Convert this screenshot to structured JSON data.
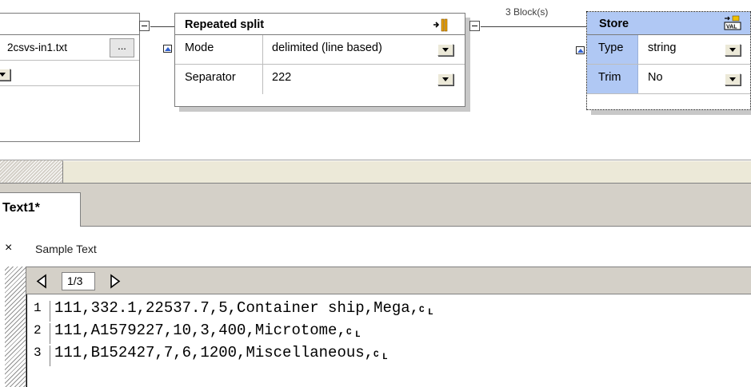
{
  "left_component": {
    "file_name": "2csvs-in1.txt",
    "browse_label": "..."
  },
  "repeated_split": {
    "title": "Repeated split",
    "rows": [
      {
        "key": "Mode",
        "value": "delimited (line based)"
      },
      {
        "key": "Separator",
        "value": "222"
      }
    ]
  },
  "connection_label": "3 Block(s)",
  "store": {
    "title": "Store",
    "rows": [
      {
        "key": "Type",
        "value": "string"
      },
      {
        "key": "Trim",
        "value": "No"
      }
    ]
  },
  "tabs": [
    {
      "label": "Text1*"
    }
  ],
  "sample_panel": {
    "close_label": "×",
    "title": "Sample Text",
    "page_indicator": "1/3",
    "lines": [
      {
        "num": "1",
        "text": "111,332.1,22537.7,5,Container ship,Mega,"
      },
      {
        "num": "2",
        "text": "111,A1579227,10,3,400,Microtome,"
      },
      {
        "num": "3",
        "text": "111,B152427,7,6,1200,Miscellaneous,"
      }
    ]
  },
  "colors": {
    "store_header": "#b0c8f4",
    "toolbar_gray": "#d4d0c8",
    "accent_blue": "#3060d0"
  },
  "icons": [
    "split-icon",
    "val-icon",
    "crlf-icon",
    "prev-page-icon",
    "next-page-icon",
    "dropdown-arrow-icon",
    "collapse-icon"
  ]
}
